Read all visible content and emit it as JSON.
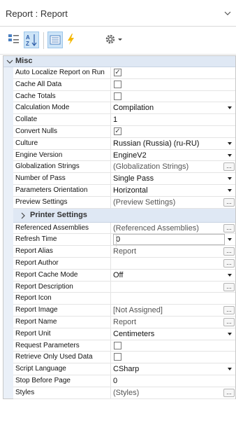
{
  "header": {
    "title": "Report : Report"
  },
  "toolbar": {
    "tools": [
      "categorized-view",
      "sort-alphabetical",
      "properties",
      "events",
      "settings"
    ]
  },
  "category": {
    "label": "Misc"
  },
  "subcategory": {
    "label": "Printer Settings"
  },
  "rows_top": [
    {
      "name": "Auto Localize Report on Run",
      "kind": "check",
      "checked": true,
      "value": "✓"
    },
    {
      "name": "Cache All Data",
      "kind": "check",
      "checked": false,
      "value": ""
    },
    {
      "name": "Cache Totals",
      "kind": "check",
      "checked": false,
      "value": ""
    },
    {
      "name": "Calculation Mode",
      "kind": "dropdown",
      "value": "Compilation"
    },
    {
      "name": "Collate",
      "kind": "text",
      "value": "1"
    },
    {
      "name": "Convert Nulls",
      "kind": "check",
      "checked": true,
      "value": "✓"
    },
    {
      "name": "Culture",
      "kind": "dropdown",
      "value": "Russian (Russia)  (ru-RU)"
    },
    {
      "name": "Engine Version",
      "kind": "dropdown",
      "value": "EngineV2"
    },
    {
      "name": "Globalization Strings",
      "kind": "ellipsis",
      "value": "(Globalization Strings)"
    },
    {
      "name": "Number of Pass",
      "kind": "dropdown",
      "value": "Single Pass"
    },
    {
      "name": "Parameters Orientation",
      "kind": "dropdown",
      "value": "Horizontal"
    },
    {
      "name": "Preview Settings",
      "kind": "ellipsis",
      "value": "(Preview Settings)"
    }
  ],
  "rows_bottom": [
    {
      "name": "Referenced Assemblies",
      "kind": "ellipsis",
      "value": "(Referenced Assemblies)"
    },
    {
      "name": "Refresh Time",
      "kind": "number",
      "value": "0"
    },
    {
      "name": "Report Alias",
      "kind": "ellipsis",
      "value": "Report"
    },
    {
      "name": "Report Author",
      "kind": "ellipsis",
      "value": ""
    },
    {
      "name": "Report Cache Mode",
      "kind": "dropdown",
      "value": "Off"
    },
    {
      "name": "Report Description",
      "kind": "ellipsis",
      "value": ""
    },
    {
      "name": "Report Icon",
      "kind": "text",
      "value": ""
    },
    {
      "name": "Report Image",
      "kind": "ellipsis",
      "value": "[Not Assigned]"
    },
    {
      "name": "Report Name",
      "kind": "ellipsis",
      "value": "Report"
    },
    {
      "name": "Report Unit",
      "kind": "dropdown",
      "value": "Centimeters"
    },
    {
      "name": "Request Parameters",
      "kind": "check",
      "checked": false,
      "value": ""
    },
    {
      "name": "Retrieve Only Used Data",
      "kind": "check",
      "checked": false,
      "value": ""
    },
    {
      "name": "Script Language",
      "kind": "dropdown",
      "value": "CSharp"
    },
    {
      "name": "Stop Before Page",
      "kind": "text",
      "value": "0"
    },
    {
      "name": "Styles",
      "kind": "ellipsis",
      "value": "(Styles)"
    }
  ],
  "ellipsis_label": "...",
  "colors": {
    "accent": "#cde4f7",
    "category_bg": "#dfe8f4",
    "lightning": "#f5b700"
  }
}
